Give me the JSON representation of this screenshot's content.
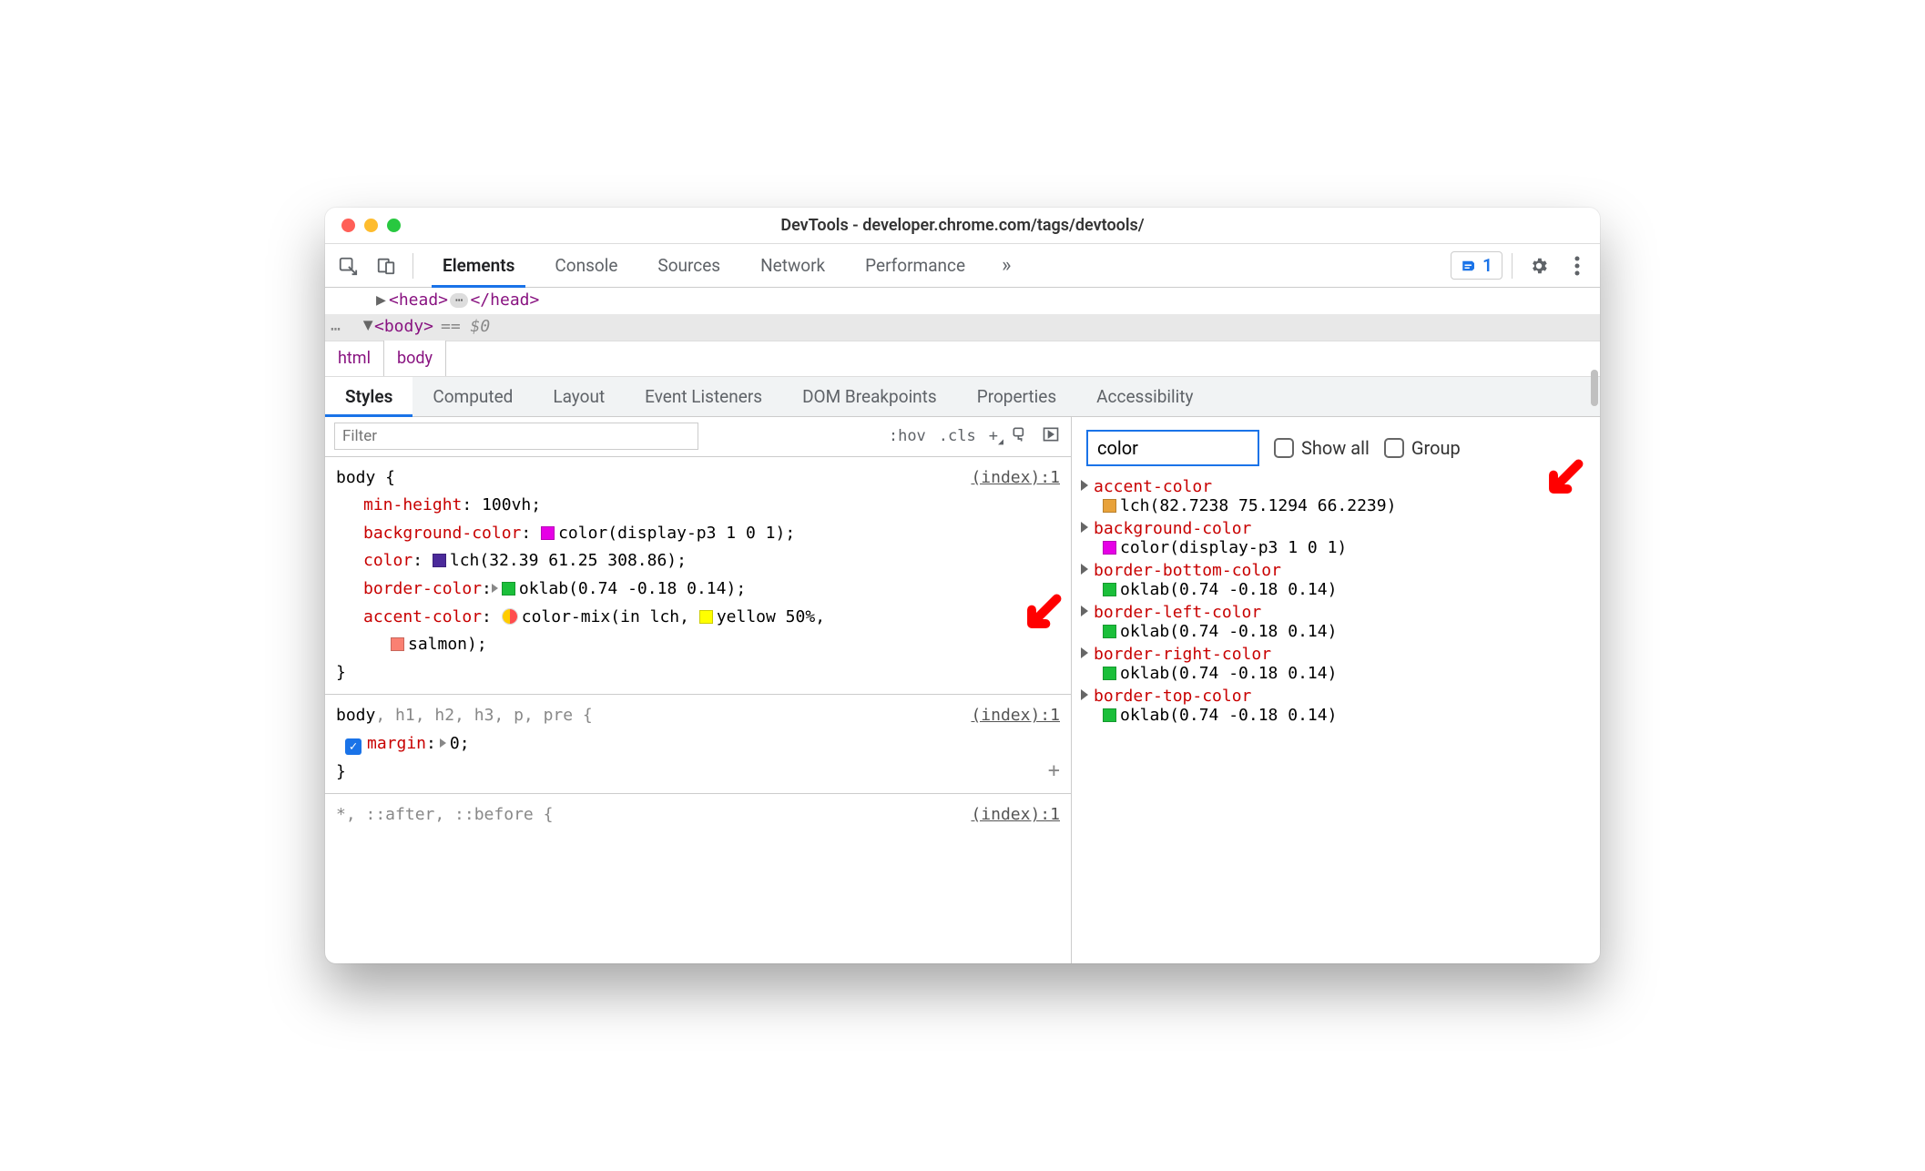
{
  "window": {
    "title": "DevTools - developer.chrome.com/tags/devtools/"
  },
  "mainTabs": [
    "Elements",
    "Console",
    "Sources",
    "Network",
    "Performance"
  ],
  "mainTabsActive": "Elements",
  "issueCount": "1",
  "dom": {
    "head_open": "<head>",
    "head_close": "</head>",
    "body_open": "<body>",
    "eq": "== $0"
  },
  "breadcrumbs": [
    "html",
    "body"
  ],
  "breadcrumbsActive": "body",
  "subTabs": [
    "Styles",
    "Computed",
    "Layout",
    "Event Listeners",
    "DOM Breakpoints",
    "Properties",
    "Accessibility"
  ],
  "subTabsActive": "Styles",
  "stylesToolbar": {
    "filterPlaceholder": "Filter",
    "hov": ":hov",
    "cls": ".cls",
    "plus": "+"
  },
  "rule1": {
    "selector": "body {",
    "source": "(index):1",
    "close": "}",
    "d1_prop": "min-height",
    "d1_val": "100vh",
    "d2_prop": "background-color",
    "d2_val": "color(display-p3 1 0 1)",
    "d2_swatch": "#e600e6",
    "d3_prop": "color",
    "d3_val": "lch(32.39 61.25 308.86)",
    "d3_swatch": "#4b2a9a",
    "d4_prop": "border-color",
    "d4_val": "oklab(0.74 -0.18 0.14)",
    "d4_swatch": "#1bbf3a",
    "d5_prop": "accent-color",
    "d5_valA": "color-mix(in lch, ",
    "d5_yellow": "yellow",
    "d5_valB": " 50%,",
    "d5_salmon": "salmon",
    "d5_valC": ");",
    "d5_swatchYellow": "#ffff00",
    "d5_swatchSalmon": "#fa8072",
    "d5_mixL": "#ffcc00",
    "d5_mixR": "#ff4d4d"
  },
  "rule2": {
    "selector_main": "body",
    "selector_rest": ", h1, h2, h3, p, pre {",
    "source": "(index):1",
    "close": "}",
    "d1_prop": "margin",
    "d1_val": "0"
  },
  "rule3": {
    "selector": "*, ::after, ::before {",
    "source": "(index):1"
  },
  "computed": {
    "filterValue": "color",
    "showAll": "Show all",
    "group": "Group",
    "items": [
      {
        "prop": "accent-color",
        "swatch": "#e8a23a",
        "val": "lch(82.7238 75.1294 66.2239)"
      },
      {
        "prop": "background-color",
        "swatch": "#e600e6",
        "val": "color(display-p3 1 0 1)"
      },
      {
        "prop": "border-bottom-color",
        "swatch": "#1bbf3a",
        "val": "oklab(0.74 -0.18 0.14)"
      },
      {
        "prop": "border-left-color",
        "swatch": "#1bbf3a",
        "val": "oklab(0.74 -0.18 0.14)"
      },
      {
        "prop": "border-right-color",
        "swatch": "#1bbf3a",
        "val": "oklab(0.74 -0.18 0.14)"
      },
      {
        "prop": "border-top-color",
        "swatch": "#1bbf3a",
        "val": "oklab(0.74 -0.18 0.14)"
      }
    ]
  }
}
